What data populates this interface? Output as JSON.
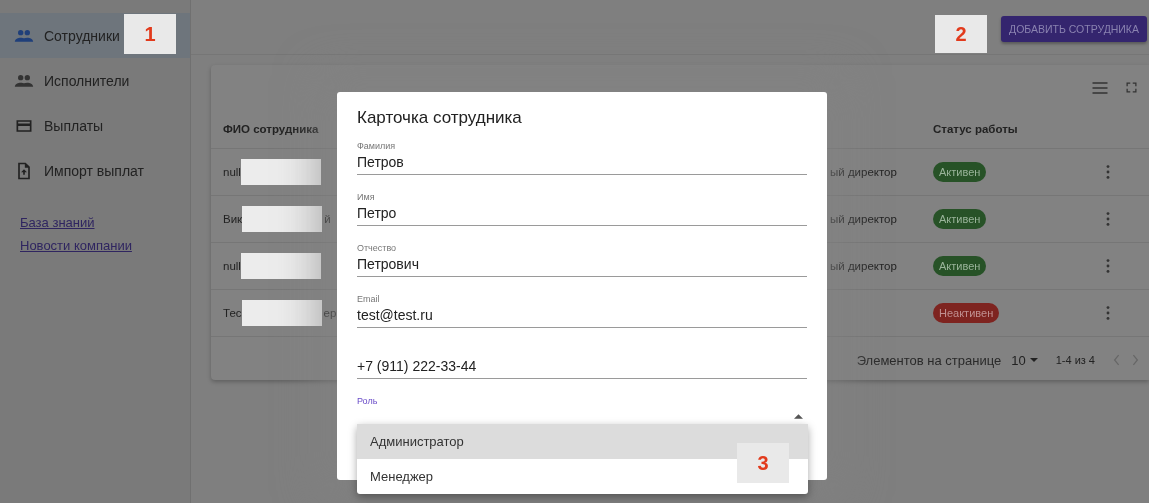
{
  "sidebar": {
    "items": [
      {
        "label": "Сотрудники",
        "kind": "people",
        "selected": true
      },
      {
        "label": "Исполнители",
        "kind": "people",
        "selected": false
      },
      {
        "label": "Выплаты",
        "kind": "card",
        "selected": false
      },
      {
        "label": "Импорт выплат",
        "kind": "upload",
        "selected": false
      }
    ],
    "links": [
      "База знаний",
      "Новости компании"
    ]
  },
  "header": {
    "add_button": "ДОБАВИТЬ СОТРУДНИКА"
  },
  "table": {
    "columns": [
      "ФИО сотрудника",
      "Статус работы"
    ],
    "rows": [
      {
        "name_start": "null",
        "name_end": "",
        "column_3": "ый директор",
        "status": "Активен",
        "active": true
      },
      {
        "name_start": "Вик",
        "name_end": "й",
        "column_3": "ый директор",
        "status": "Активен",
        "active": true
      },
      {
        "name_start": "null",
        "name_end": "",
        "column_3": "ый директор",
        "status": "Активен",
        "active": true
      },
      {
        "name_start": "Тес",
        "name_end": "ер",
        "status": "Неактивен",
        "active": false
      }
    ],
    "pagination": {
      "label": "Элементов на странице",
      "per_page": "10",
      "range": "1-4 из 4"
    }
  },
  "dialog": {
    "title": "Карточка сотрудника",
    "fields": [
      {
        "label": "Фамилия",
        "value": "Петров"
      },
      {
        "label": "Имя",
        "value": "Петро"
      },
      {
        "label": "Отчество",
        "value": "Петрович"
      },
      {
        "label": "Email",
        "value": "test@test.ru"
      },
      {
        "value": "+7 (911) 222-33-44"
      }
    ],
    "role": {
      "label": "Роль",
      "options": [
        {
          "label": "Администратор",
          "selected": true
        },
        {
          "label": "Менеджер",
          "selected": false
        }
      ]
    }
  },
  "markers": [
    "1",
    "2",
    "3"
  ]
}
